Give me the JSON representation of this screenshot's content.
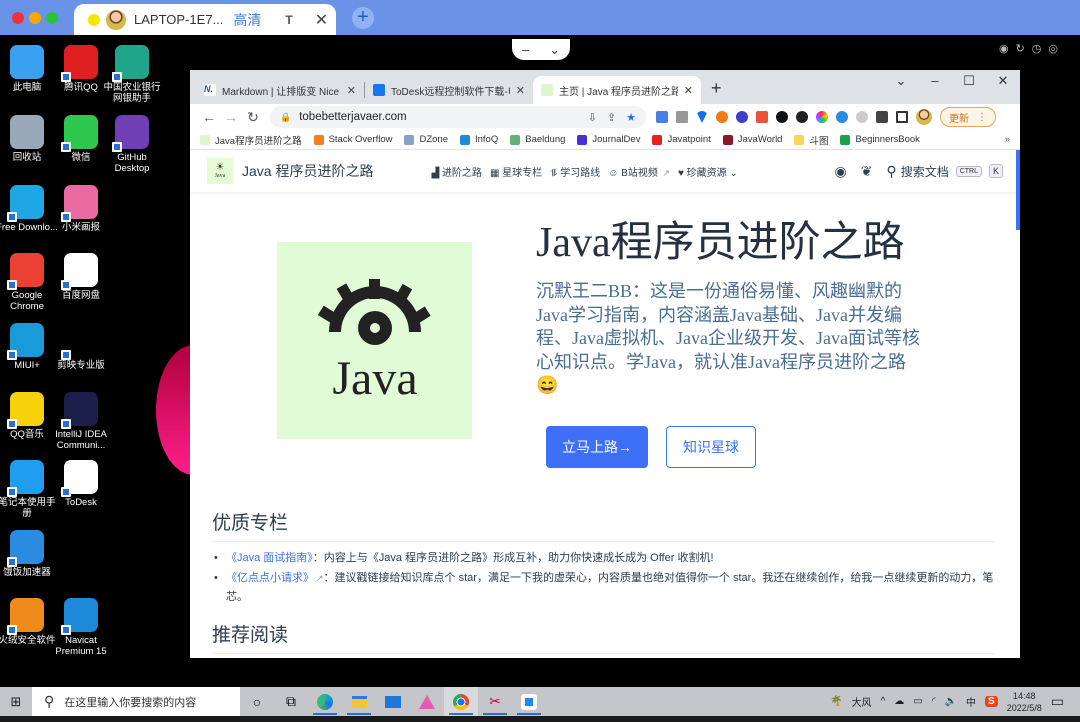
{
  "remote_app": {
    "tab_title": "LAPTOP-1E7...",
    "quality_label": "高清",
    "t_label": "T",
    "close_glyph": "✕",
    "new_tab_glyph": "+",
    "pill_minimize": "–",
    "pill_collapse": "⌄"
  },
  "desktop_icons": [
    {
      "label": "此电脑",
      "icon": "computer-icon",
      "color": "#3aa0f0"
    },
    {
      "label": "腾讯QQ",
      "icon": "qq-icon",
      "color": "#e02020"
    },
    {
      "label": "中国农业银行网银助手",
      "icon": "abc-bank-icon",
      "color": "#20a58a"
    },
    {
      "label": "回收站",
      "icon": "recycle-bin-icon",
      "color": "#9aa9b9"
    },
    {
      "label": "微信",
      "icon": "wechat-icon",
      "color": "#2dc84d"
    },
    {
      "label": "GitHub Desktop",
      "icon": "github-desktop-icon",
      "color": "#6e3fb5"
    },
    {
      "label": "Free Downlo...",
      "icon": "free-download-manager-icon",
      "color": "#1fa7e3"
    },
    {
      "label": "小米画报",
      "icon": "mi-wallpaper-icon",
      "color": "#e86aa0"
    },
    {
      "label": "Google Chrome",
      "icon": "chrome-icon",
      "color": "#e94235"
    },
    {
      "label": "百度网盘",
      "icon": "baidu-netdisk-icon",
      "color": "#ffffff"
    },
    {
      "label": "MIUI+",
      "icon": "miui-plus-icon",
      "color": "#1a9ad9"
    },
    {
      "label": "剪映专业版",
      "icon": "capcut-icon",
      "color": "#000000"
    },
    {
      "label": "QQ音乐",
      "icon": "qq-music-icon",
      "color": "#f5d20c"
    },
    {
      "label": "IntelliJ IDEA Communi...",
      "icon": "intellij-idea-icon",
      "color": "#1b1f4a"
    },
    {
      "label": "笔记本使用手册",
      "icon": "laptop-manual-icon",
      "color": "#1f9df0"
    },
    {
      "label": "ToDesk",
      "icon": "todesk-icon",
      "color": "#ffffff"
    },
    {
      "label": "饿饭加速器",
      "icon": "accelerator-icon",
      "color": "#2a8be0"
    },
    {
      "label": "火绒安全软件",
      "icon": "huorong-icon",
      "color": "#f08a1a"
    },
    {
      "label": "Navicat Premium 15",
      "icon": "navicat-icon",
      "color": "#1d8ad9"
    }
  ],
  "browser": {
    "tabs": [
      {
        "label": "Markdown | 让排版变 Nice",
        "icon": "mdnice-icon",
        "color": "#1f4bd6",
        "active": false
      },
      {
        "label": "ToDesk远程控制软件下载-电脑远",
        "icon": "todesk-icon",
        "color": "#1576f0",
        "active": false
      },
      {
        "label": "主页 | Java 程序员进阶之路",
        "icon": "site-favicon",
        "color": "#dff5cf",
        "active": true
      }
    ],
    "new_tab": "+",
    "window_controls": [
      "⌄",
      "–",
      "☐",
      "✕"
    ],
    "url": "tobebetterjavaer.com",
    "update_label": "更新",
    "bookmarks": [
      {
        "label": "Java程序员进阶之路",
        "color": "#dff5cf"
      },
      {
        "label": "Stack Overflow",
        "color": "#f48024"
      },
      {
        "label": "DZone",
        "color": "#8aa0c8"
      },
      {
        "label": "InfoQ",
        "color": "#1e8cd8"
      },
      {
        "label": "Baeldung",
        "color": "#63b175"
      },
      {
        "label": "JournalDev",
        "color": "#4b2fd6"
      },
      {
        "label": "Javatpoint",
        "color": "#e8201b"
      },
      {
        "label": "JavaWorld",
        "color": "#8a1628"
      },
      {
        "label": "斗图",
        "color": "#f7d654"
      },
      {
        "label": "BeginnersBook",
        "color": "#1aa34a"
      }
    ],
    "bookmarks_more": "»"
  },
  "site": {
    "logo_text": "Java",
    "title": "Java 程序员进阶之路",
    "nav": [
      {
        "label": "进阶之路",
        "icon": "chart-icon"
      },
      {
        "label": "星球专栏",
        "icon": "grid-icon"
      },
      {
        "label": "学习路线",
        "icon": "route-icon"
      },
      {
        "label": "B站视频",
        "icon": "bilibili-icon",
        "external": true
      },
      {
        "label": "珍藏资源",
        "icon": "heart-icon",
        "dropdown": true
      }
    ],
    "search_label": "搜索文档",
    "kbd_ctrl": "CTRL",
    "kbd_k": "K",
    "hero": {
      "title": "Java程序员进阶之路",
      "description": "沉默王二BB：这是一份通俗易懂、风趣幽默的Java学习指南，内容涵盖Java基础、Java并发编程、Java虚拟机、Java企业级开发、Java面试等核心知识点。学Java，就认准Java程序员进阶之路😄",
      "logo_word": "Java",
      "primary_button": "立马上路→",
      "secondary_button": "知识星球"
    },
    "section1_title": "优质专栏",
    "items": [
      {
        "link": "《Java 面试指南》",
        "external": false,
        "text": "：内容上与《Java 程序员进阶之路》形成互补，助力你快速成长成为 Offer 收割机!"
      },
      {
        "link": "《亿点点小请求》",
        "external": true,
        "text": "：建议戳链接给知识库点个 star，满足一下我的虚荣心，内容质量也绝对值得你一个 star。我还在继续创作，给我一点继续更新的动力，笔芯。"
      }
    ],
    "section2_title": "推荐阅读",
    "accent_color": "#3e6ff7"
  },
  "taskbar": {
    "search_placeholder": "在这里输入你要搜索的内容",
    "apps": [
      "cortana-icon",
      "task-view-icon",
      "edge-icon",
      "file-explorer-icon",
      "mail-icon",
      "app-icon",
      "chrome-icon",
      "snipping-icon",
      "todesk-icon"
    ],
    "weather": "大风",
    "ime": "中",
    "time": "14:48",
    "date": "2022/5/8"
  }
}
